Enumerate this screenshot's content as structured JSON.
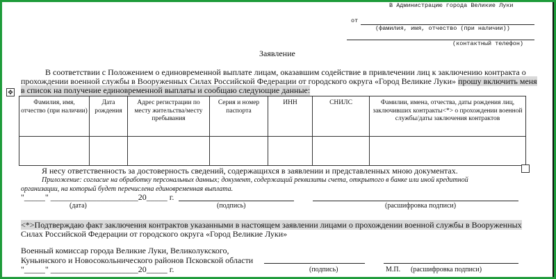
{
  "header": {
    "to": "В Администрацию города Великие Луки",
    "from_prefix": "от",
    "fio_hint": "(фамилия, имя, отчество (при наличии))",
    "contact_hint": "(контактный телефон)"
  },
  "title": "Заявление",
  "intro": {
    "line1": "В соответствии с Положением о единовременной выплате лицам, оказавшим содействие в привлечении лиц к заключению контракта о",
    "line2_a": "прохождении военной службы в Вооруженных Силах Российской Федерации от городского округа «Город Великие Луки» ",
    "line2_b": "прошу включить меня",
    "line3": "в список на получение единовременной выплаты и сообщаю следующие данные:"
  },
  "table": {
    "headers": [
      "Фамилия, имя, отчество (при наличии)",
      "Дата рождения",
      "Адрес регистрации по месту жительства/месту пребывания",
      "Серия и номер паспорта",
      "ИНН",
      "СНИЛС",
      "Фамилии, имена, отчества, даты рождения лиц, заключивших контракты<*> о прохождении военной службы/даты заключения контрактов"
    ]
  },
  "responsibility": "Я несу ответственность за достоверность сведений, содержащихся в заявлении и представленных мною документах.",
  "appendix": {
    "line1": "Приложение: согласие на обработку персональных данных; документ, содержащий реквизиты счета, открытого в банке или иной кредитной",
    "line2": "организации, на который будет перечислена единовременная выплата."
  },
  "sign1": {
    "date_line": "\"_____\" _____________________20_____ г.",
    "date_label": "(дата)",
    "signature_label": "(подпись)",
    "decode_label": "(расшифровка подписи)"
  },
  "confirm": {
    "line1": "<*>Подтверждаю факт заключения контрактов указанными в настоящем заявлении лицами о прохождении военной службы в Вооруженных",
    "line2": "Силах Российской Федерации от городского округа «Город Великие Луки»"
  },
  "commissar": {
    "line1": "Военный комиссар города Великие Луки, Великолукского,",
    "line2": "Куньинского и Новосокольнического районов Псковской области",
    "date_line": "\"_____\" _____________________20_____ г.",
    "signature_label": "(подпись)",
    "mp_label": "М.П.",
    "decode_label": "(расшифровка подписи)"
  }
}
